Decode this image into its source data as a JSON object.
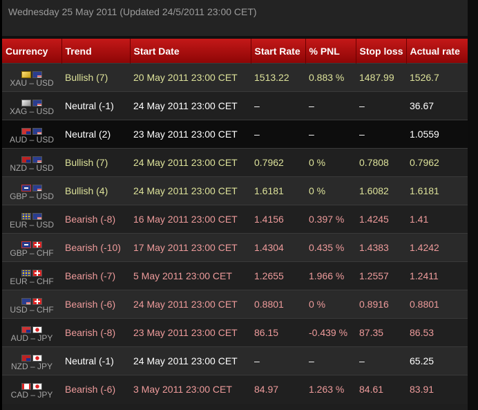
{
  "header": {
    "date_line": "Wednesday 25 May 2011 (Updated 24/5/2011 23:00 CET)"
  },
  "columns": [
    "Currency",
    "Trend",
    "Start Date",
    "Start Rate",
    "% PNL",
    "Stop loss",
    "Actual rate"
  ],
  "rows": [
    {
      "pair": "XAU – USD",
      "flags": [
        "gold-bar-icon",
        "us-flag-icon"
      ],
      "trend": "Bullish (7)",
      "kind": "bull",
      "start_date": "20 May 2011 23:00 CET",
      "start_rate": "1513.22",
      "pnl": "0.883 %",
      "stop_loss": "1487.99",
      "actual_rate": "1526.7"
    },
    {
      "pair": "XAG – USD",
      "flags": [
        "silver-bar-icon",
        "us-flag-icon"
      ],
      "trend": "Neutral (-1)",
      "kind": "neut",
      "start_date": "24 May 2011 23:00 CET",
      "start_rate": "–",
      "pnl": "–",
      "stop_loss": "–",
      "actual_rate": "36.67"
    },
    {
      "pair": "AUD – USD",
      "flags": [
        "au-flag-icon",
        "us-flag-icon"
      ],
      "trend": "Neutral (2)",
      "kind": "neut",
      "start_date": "23 May 2011 23:00 CET",
      "start_rate": "–",
      "pnl": "–",
      "stop_loss": "–",
      "actual_rate": "1.0559"
    },
    {
      "pair": "NZD – USD",
      "flags": [
        "nz-flag-icon",
        "us-flag-icon"
      ],
      "trend": "Bullish (7)",
      "kind": "bull",
      "start_date": "24 May 2011 23:00 CET",
      "start_rate": "0.7962",
      "pnl": "0 %",
      "stop_loss": "0.7808",
      "actual_rate": "0.7962"
    },
    {
      "pair": "GBP – USD",
      "flags": [
        "gb-flag-icon",
        "us-flag-icon"
      ],
      "trend": "Bullish (4)",
      "kind": "bull",
      "start_date": "24 May 2011 23:00 CET",
      "start_rate": "1.6181",
      "pnl": "0 %",
      "stop_loss": "1.6082",
      "actual_rate": "1.6181"
    },
    {
      "pair": "EUR – USD",
      "flags": [
        "eu-flag-icon",
        "us-flag-icon"
      ],
      "trend": "Bearish (-8)",
      "kind": "bear",
      "start_date": "16 May 2011 23:00 CET",
      "start_rate": "1.4156",
      "pnl": "0.397 %",
      "stop_loss": "1.4245",
      "actual_rate": "1.41"
    },
    {
      "pair": "GBP – CHF",
      "flags": [
        "gb-flag-icon",
        "ch-flag-icon"
      ],
      "trend": "Bearish (-10)",
      "kind": "bear",
      "start_date": "17 May 2011 23:00 CET",
      "start_rate": "1.4304",
      "pnl": "0.435 %",
      "stop_loss": "1.4383",
      "actual_rate": "1.4242"
    },
    {
      "pair": "EUR – CHF",
      "flags": [
        "eu-flag-icon",
        "ch-flag-icon"
      ],
      "trend": "Bearish (-7)",
      "kind": "bear",
      "start_date": "5 May 2011 23:00 CET",
      "start_rate": "1.2655",
      "pnl": "1.966 %",
      "stop_loss": "1.2557",
      "actual_rate": "1.2411"
    },
    {
      "pair": "USD – CHF",
      "flags": [
        "us-flag-icon",
        "ch-flag-icon"
      ],
      "trend": "Bearish (-6)",
      "kind": "bear",
      "start_date": "24 May 2011 23:00 CET",
      "start_rate": "0.8801",
      "pnl": "0 %",
      "stop_loss": "0.8916",
      "actual_rate": "0.8801"
    },
    {
      "pair": "AUD – JPY",
      "flags": [
        "au-flag-icon",
        "jp-flag-icon"
      ],
      "trend": "Bearish (-8)",
      "kind": "bear",
      "start_date": "23 May 2011 23:00 CET",
      "start_rate": "86.15",
      "pnl": "-0.439 %",
      "stop_loss": "87.35",
      "actual_rate": "86.53"
    },
    {
      "pair": "NZD – JPY",
      "flags": [
        "nz-flag-icon",
        "jp-flag-icon"
      ],
      "trend": "Neutral (-1)",
      "kind": "neut",
      "start_date": "24 May 2011 23:00 CET",
      "start_rate": "–",
      "pnl": "–",
      "stop_loss": "–",
      "actual_rate": "65.25"
    },
    {
      "pair": "CAD – JPY",
      "flags": [
        "ca-flag-icon",
        "jp-flag-icon"
      ],
      "trend": "Bearish (-6)",
      "kind": "bear",
      "start_date": "3 May 2011 23:00 CET",
      "start_rate": "84.97",
      "pnl": "1.263 %",
      "stop_loss": "84.61",
      "actual_rate": "83.91"
    }
  ],
  "colors": {
    "header_red": "#b01010",
    "bullish_text": "#dde29a",
    "bearish_text": "#ee9b9b",
    "neutral_text": "#ffffff",
    "row_odd": "#2a2a2a",
    "row_even": "#202020"
  }
}
